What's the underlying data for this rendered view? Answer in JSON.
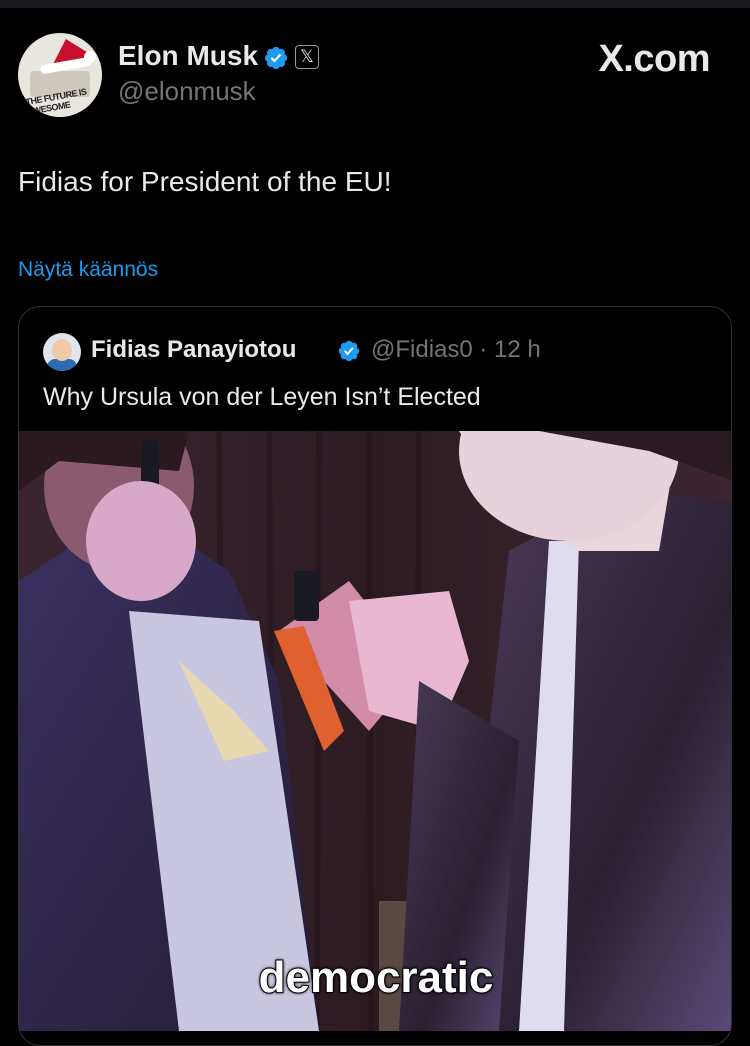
{
  "author": {
    "name": "Elon Musk",
    "handle": "@elonmusk",
    "avatar_icon": "avatar-santa-hat-icon",
    "avatar_caption": "THE FUTURE IS AWESOME"
  },
  "brand": "X.com",
  "x_badge_glyph": "𝕏",
  "tweet": {
    "text": "Fidias for President of the EU!",
    "translate_link": "Näytä käännös"
  },
  "quoted": {
    "name": "Fidias Panayiotou",
    "handle_time": "@Fidias0 · 12 h",
    "text": "Why Ursula von der Leyen Isn’t Elected",
    "video_subtitle": "democratic"
  },
  "colors": {
    "background": "#000000",
    "text": "#e7e9ea",
    "secondary": "#71767b",
    "link": "#1d9bf0",
    "verified": "#1d9bf0",
    "border": "#2f3336"
  }
}
